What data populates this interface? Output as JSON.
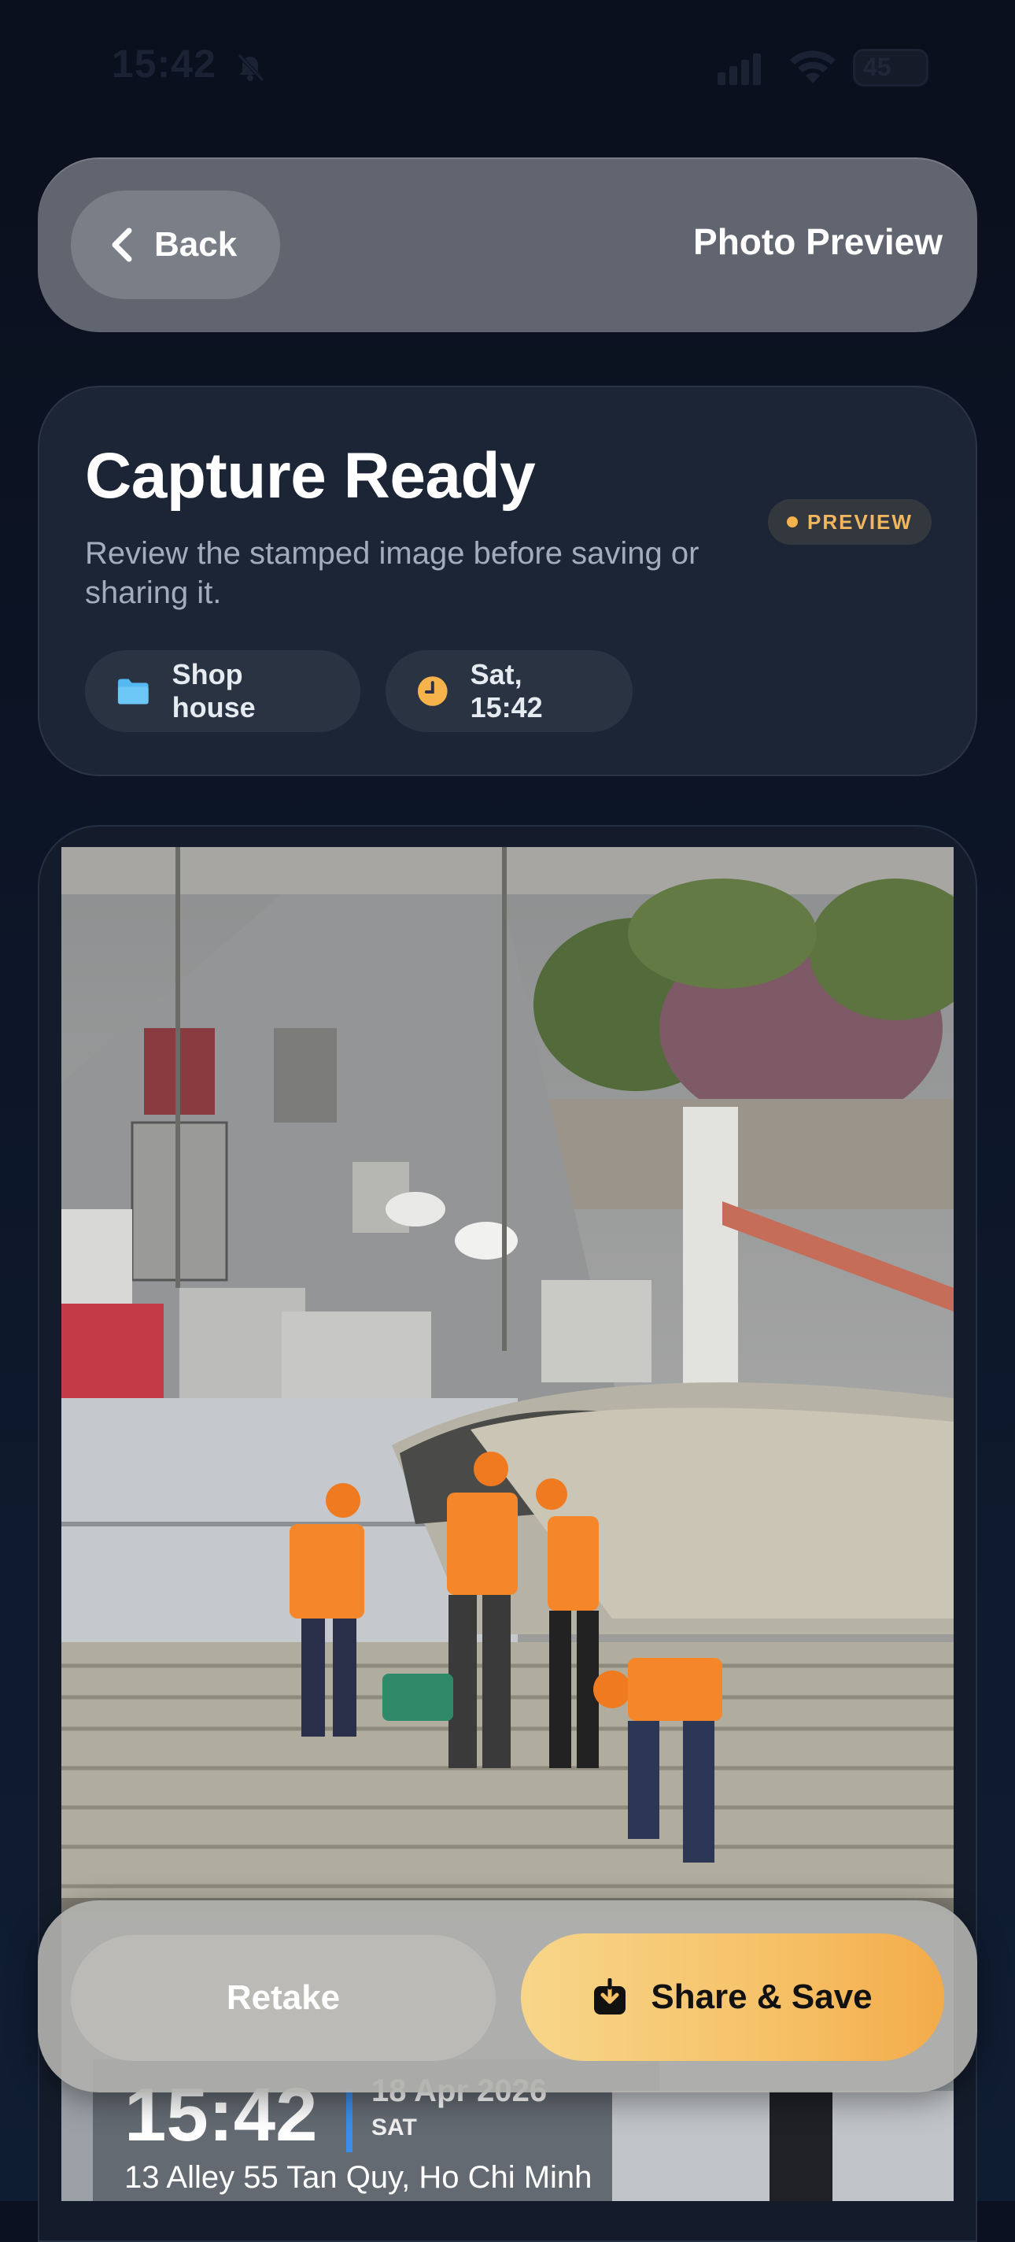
{
  "status_bar": {
    "time": "15:42",
    "battery": "45"
  },
  "nav": {
    "back_label": "Back",
    "title": "Photo Preview"
  },
  "capture": {
    "title": "Capture Ready",
    "description": "Review the stamped image before saving or sharing it.",
    "badge": "PREVIEW",
    "folder_chip": "Shop house",
    "time_chip": "Sat, 15:42"
  },
  "stamp": {
    "time": "15:42",
    "date": "18 Apr 2026",
    "day": "SAT",
    "address": "13 Alley 55 Tan Quy, Ho Chi Minh"
  },
  "actions": {
    "retake_label": "Retake",
    "share_label": "Share & Save"
  },
  "colors": {
    "accent": "#f6c167",
    "background": "#0b1120",
    "stamp_bar": "#3a8ee8"
  }
}
